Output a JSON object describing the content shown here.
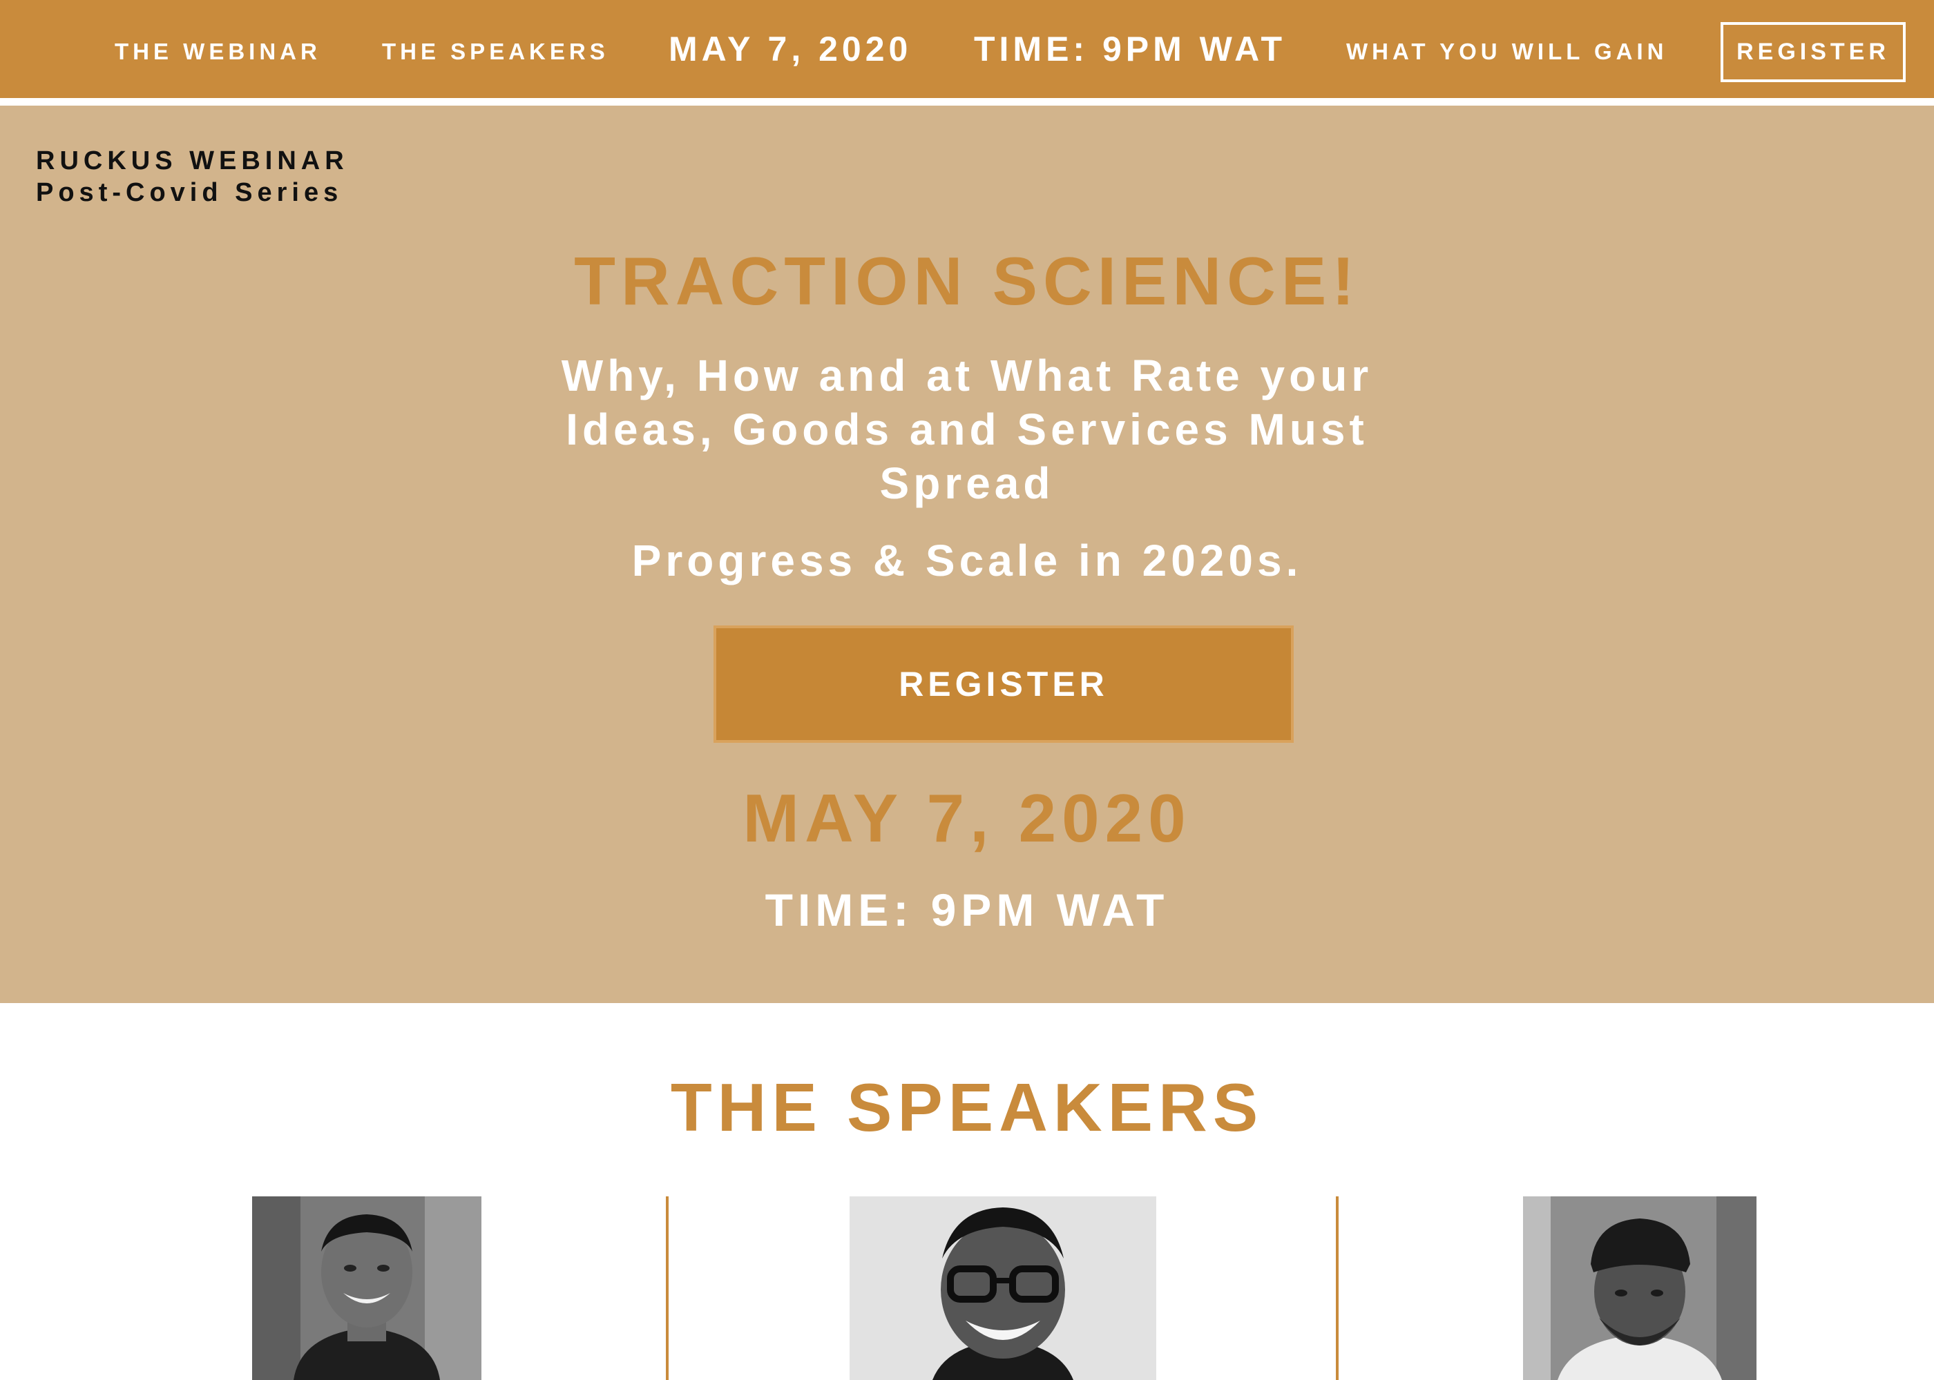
{
  "nav": {
    "webinar": "THE WEBINAR",
    "speakers": "THE SPEAKERS",
    "date": "MAY 7, 2020",
    "time": "TIME: 9PM WAT",
    "gain": "WHAT YOU WILL GAIN",
    "register": "REGISTER"
  },
  "brand": {
    "name": "RUCKUS WEBINAR",
    "series": "Post-Covid Series"
  },
  "hero": {
    "title": "TRACTION SCIENCE!",
    "subtitle_lines": [
      "Why, How and at What Rate your",
      "Ideas, Goods and Services Must",
      "Spread"
    ],
    "tagline": "Progress & Scale in 2020s.",
    "register": "REGISTER",
    "date": "MAY 7, 2020",
    "time": "TIME: 9PM WAT"
  },
  "speakers": {
    "title": "THE SPEAKERS",
    "photos": [
      {
        "icon": "speaker-photo-1"
      },
      {
        "icon": "speaker-photo-2"
      },
      {
        "icon": "speaker-photo-3"
      }
    ]
  },
  "colors": {
    "accent": "#c98b3c",
    "hero_bg": "#d2b48c",
    "button": "#c68736",
    "text_light": "#ffffff",
    "text_dark": "#111111"
  }
}
